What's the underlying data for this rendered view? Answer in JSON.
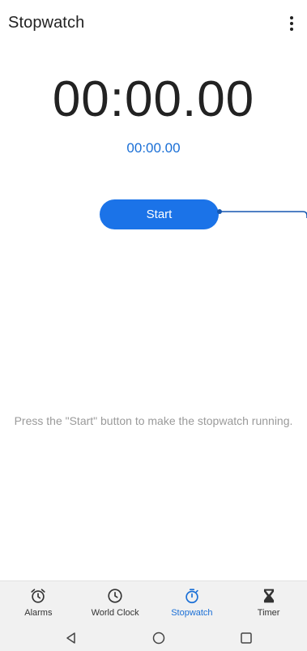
{
  "app": {
    "title": "Stopwatch",
    "menu_icon": "more-vert-icon"
  },
  "stopwatch": {
    "main_time": "00:00.00",
    "lap_time": "00:00.00",
    "start_label": "Start",
    "hint": "Press the \"Start\" button to make the stopwatch running."
  },
  "bottom_nav": {
    "items": [
      {
        "label": "Alarms",
        "icon": "alarm-clock-icon",
        "active": false
      },
      {
        "label": "World Clock",
        "icon": "clock-icon",
        "active": false
      },
      {
        "label": "Stopwatch",
        "icon": "stopwatch-icon",
        "active": true
      },
      {
        "label": "Timer",
        "icon": "hourglass-icon",
        "active": false
      }
    ]
  },
  "system_nav": {
    "back_icon": "back-triangle-icon",
    "home_icon": "home-circle-icon",
    "recents_icon": "recents-square-icon"
  },
  "colors": {
    "accent": "#1b73e8",
    "accent_text": "#1a6fd6",
    "hint_text": "#9a9a9a",
    "nav_background": "#f1f1f1"
  }
}
